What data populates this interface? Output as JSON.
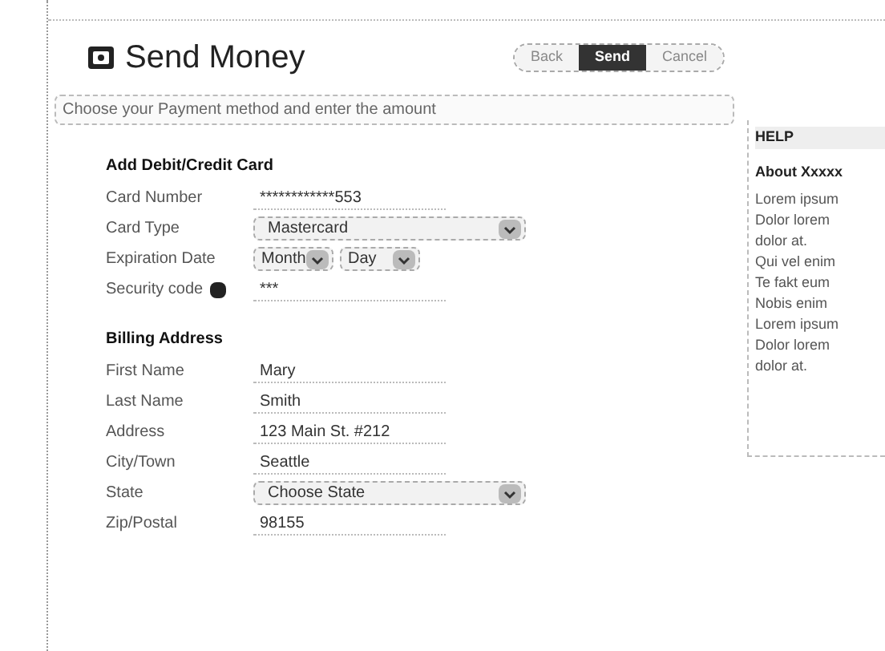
{
  "title": "Send Money",
  "steps": [
    {
      "label": "Back",
      "selected": false
    },
    {
      "label": "Send",
      "selected": true
    },
    {
      "label": "Cancel",
      "selected": false
    }
  ],
  "instructions": "Choose your Payment method and enter the amount",
  "sections": [
    {
      "heading": "Add Debit/Credit Card",
      "fields": [
        {
          "kind": "text",
          "label": "Card Number",
          "value": "************553"
        },
        {
          "kind": "select",
          "label": "Card Type",
          "value": "Mastercard"
        },
        {
          "kind": "date",
          "label": "Expiration Date",
          "month": "Month",
          "day": "Day"
        },
        {
          "kind": "text",
          "label": "Security code",
          "value": "***",
          "help": true
        }
      ]
    },
    {
      "heading": "Billing Address",
      "fields": [
        {
          "kind": "text",
          "label": "First Name",
          "value": "Mary"
        },
        {
          "kind": "text",
          "label": "Last Name",
          "value": "Smith"
        },
        {
          "kind": "text",
          "label": "Address",
          "value": "123 Main St. #212"
        },
        {
          "kind": "text",
          "label": "City/Town",
          "value": "Seattle"
        },
        {
          "kind": "select",
          "label": "State",
          "value": "Choose State"
        },
        {
          "kind": "text",
          "label": "Zip/Postal",
          "value": "98155"
        }
      ]
    }
  ],
  "help": {
    "title": "HELP",
    "heading": "About Xxxxx",
    "lines": [
      "Lorem ipsum",
      "Dolor lorem",
      "dolor at.",
      "Qui vel enim",
      "Te fakt eum",
      "Nobis enim",
      "Lorem ipsum",
      "Dolor lorem",
      "dolor at."
    ]
  }
}
